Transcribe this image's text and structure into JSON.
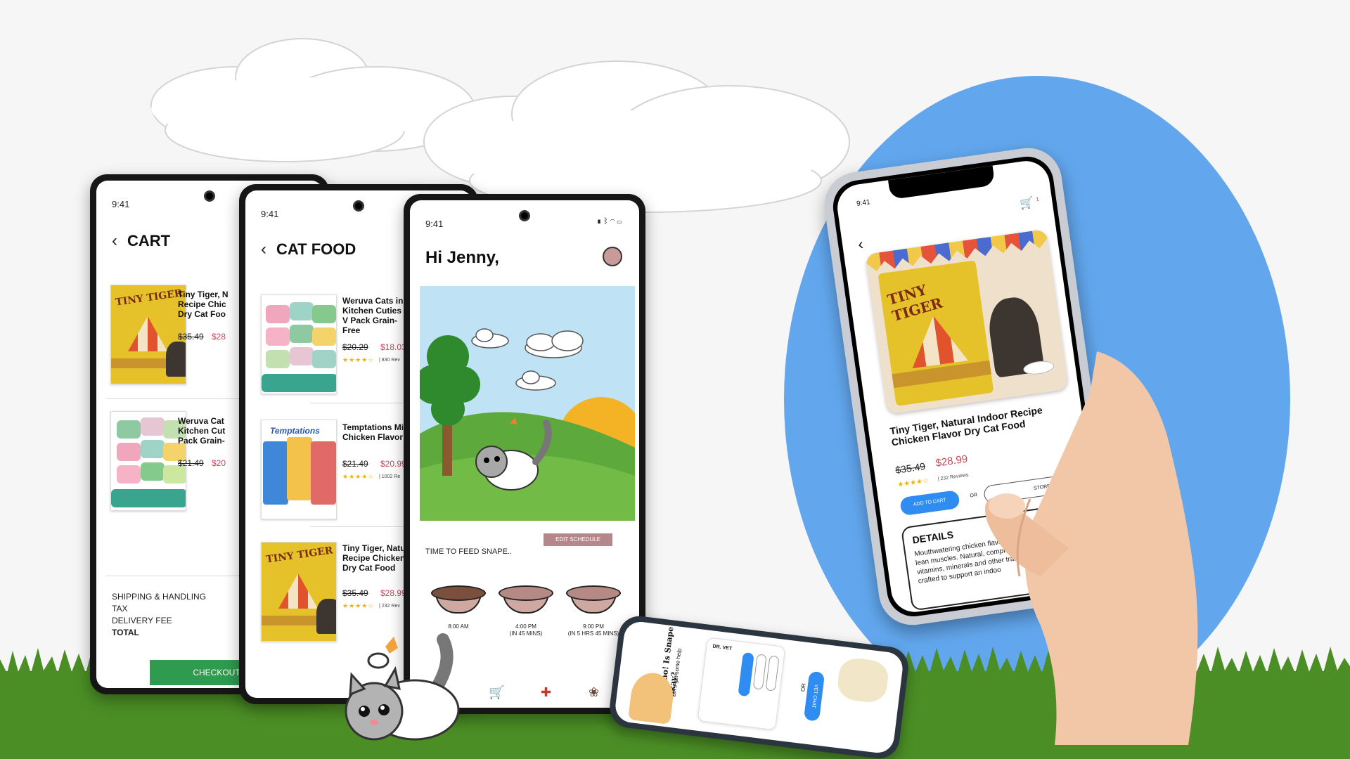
{
  "colors": {
    "sky_oval": "#62a7ee",
    "grass": "#4b8e25",
    "price_sale": "#c04a5a",
    "checkout": "#2e9b4e",
    "schedule_btn": "#b5868a",
    "add_to_cart": "#2f8cf0"
  },
  "cart_phone": {
    "time": "9:41",
    "title": "CART",
    "items": [
      {
        "name": "Tiny Tiger, N Recipe Chic Dry Cat Foo",
        "old_price": "$35.49",
        "new_price": "$28"
      },
      {
        "name": "Weruva Cat Kitchen Cut Pack Grain-",
        "old_price": "$21.49",
        "new_price": "$20"
      }
    ],
    "summary": [
      "SHIPPING & HANDLING",
      "TAX",
      "DELIVERY FEE",
      "TOTAL"
    ],
    "checkout_label": "CHECKOUT"
  },
  "catfood_phone": {
    "time": "9:41",
    "title": "CAT FOOD",
    "items": [
      {
        "name": "Weruva Cats in Kitchen Cuties V Pack Grain-Free",
        "old_price": "$20.29",
        "new_price": "$18.03",
        "reviews": "| 830 Rev"
      },
      {
        "name": "Temptations Mi Chicken Flavor",
        "old_price": "$21.49",
        "new_price": "$20.99",
        "reviews": "| 1002 Re"
      },
      {
        "name": "Tiny Tiger, Natu Recipe Chicken Dry Cat Food",
        "old_price": "$35.49",
        "new_price": "$28.99",
        "reviews": "| 232 Rev"
      }
    ]
  },
  "home_phone": {
    "time": "9:41",
    "greeting": "Hi Jenny,",
    "edit_schedule": "EDIT SCHEDULE",
    "feed_prompt": "TIME TO FEED SNAPE..",
    "bowls": [
      {
        "time": "8:00 AM",
        "sub": ""
      },
      {
        "time": "4:00 PM",
        "sub": "(IN 45 MINS)"
      },
      {
        "time": "9:00 PM",
        "sub": "(IN 5 HRS 45 MINS)"
      }
    ],
    "nav_icons": [
      "bowl-icon",
      "cart-icon",
      "vet-kit-icon",
      "paw-icon"
    ]
  },
  "product_phone": {
    "time": "9:41",
    "cart_count": "1",
    "name": "Tiny Tiger, Natural Indoor Recipe Chicken Flavor Dry Cat Food",
    "old_price": "$35.49",
    "new_price": "$28.99",
    "reviews": "| 232 Reviews",
    "add_to_cart": "ADD TO CART",
    "or": "OR",
    "store_btn": "STORE",
    "details_title": "DETAILS",
    "details_text": "Mouthwatering chicken flavor protein to support lean muscles. Natural, complete recipe—with add vitamins, minerals and other trace nutrients—crafted to support an indoo"
  },
  "vet_phone": {
    "question": "Oh no! Is Snape okay?",
    "sub": "Let's get some help",
    "vet_name": "DR. VET",
    "or": "OR",
    "vet_chat": "VET CHAT"
  }
}
